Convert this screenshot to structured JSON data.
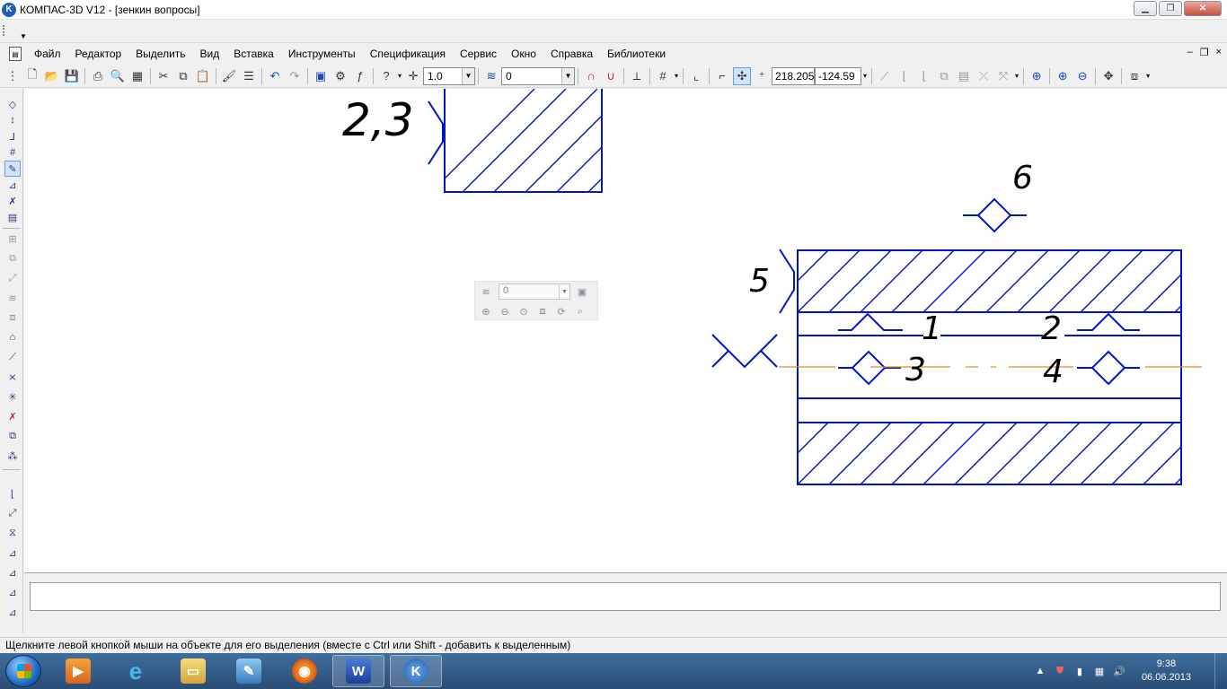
{
  "window": {
    "title": "КОМПАС-3D V12 - [зенкин вопросы]",
    "minimize": "▁",
    "restore": "❐",
    "close": "✕"
  },
  "menu": {
    "items": [
      "Файл",
      "Редактор",
      "Выделить",
      "Вид",
      "Вставка",
      "Инструменты",
      "Спецификация",
      "Сервис",
      "Окно",
      "Справка",
      "Библиотеки"
    ],
    "doc_minimize": "–",
    "doc_restore": "❐",
    "doc_close": "×"
  },
  "toolbar": {
    "step_value": "1.0",
    "layer_value": "0",
    "coord_x": "218.205",
    "coord_y": "-124.59"
  },
  "floating_palette": {
    "layer_value": "0"
  },
  "drawing": {
    "labels": {
      "top_left": "2,3",
      "n1": "1",
      "n2": "2",
      "n3": "3",
      "n4": "4",
      "n5": "5",
      "n6": "6"
    },
    "line_color": "#0014c8",
    "axis_color": "#e08a28"
  },
  "statusbar": {
    "hint": "Щелкните левой кнопкой мыши на объекте для его выделения (вместе с Ctrl или Shift - добавить к выделенным)"
  },
  "taskbar": {
    "word_label": "W",
    "kompas_label": "K",
    "time": "9:38",
    "date": "06.06.2013"
  }
}
